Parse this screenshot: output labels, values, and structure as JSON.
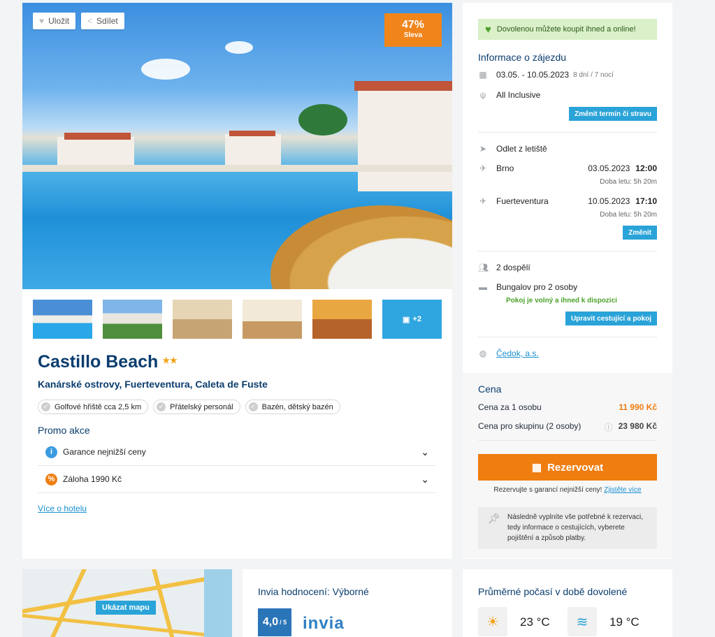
{
  "hotel": {
    "save_label": "Uložit",
    "share_label": "Sdílet",
    "discount_pct": "47%",
    "discount_label": "Sleva",
    "more_photos": "+2",
    "name": "Castillo Beach",
    "stars": "★★",
    "location": "Kanárské ostrovy, Fuerteventura, Caleta de Fuste",
    "tags": [
      "Golfové hřiště cca 2,5 km",
      "Přátelský personál",
      "Bazén, dětský bazén"
    ],
    "promo_title": "Promo akce",
    "promos": [
      {
        "label": "Garance nejnižší ceny",
        "icon": "info-icon",
        "color": "#3b9be0"
      },
      {
        "label": "Záloha 1990 Kč",
        "icon": "percent-icon",
        "color": "#ef7d10"
      }
    ],
    "more_link": "Více o hotelu"
  },
  "side": {
    "banner": "Dovolenou můžete koupit ihned a online!",
    "info_title": "Informace o zájezdu",
    "dates": "03.05. - 10.05.2023",
    "duration": "8 dní / 7 nocí",
    "board": "All Inclusive",
    "change_btn": "Změnit termín či stravu",
    "departure_label": "Odlet z letiště",
    "flights": [
      {
        "place": "Brno",
        "date": "03.05.2023",
        "time": "12:00",
        "duration": "Doba letu: 5h 20m"
      },
      {
        "place": "Fuerteventura",
        "date": "10.05.2023",
        "time": "17:10",
        "duration": "Doba letu: 5h 20m"
      }
    ],
    "change_flight_btn": "Změnit",
    "travelers": "2 dospělí",
    "room": "Bungalov pro 2 osoby",
    "room_status": "Pokoj je volný a ihned k dispozici",
    "edit_btn": "Upravit cestující a pokoj",
    "operator": "Čedok, a.s.",
    "price_title": "Cena",
    "price_person_label": "Cena za 1 osobu",
    "price_person": "11 990 Kč",
    "price_group_label": "Cena pro skupinu (2 osoby)",
    "price_group": "23 980 Kč",
    "reserve_btn": "Rezervovat",
    "reserve_note": "Rezervujte s garancí nejnižší ceny!",
    "reserve_link": "Zjistěte více",
    "info_note": "Následně vyplníte vše potřebné k rezervaci, tedy informace o cestujících, vyberete pojištění a způsob platby."
  },
  "map": {
    "button": "Ukázat mapu"
  },
  "rating": {
    "title": "Invia hodnocení: Výborné",
    "score": "4,0",
    "scale": "/ 5",
    "logo": "invia"
  },
  "weather": {
    "title": "Průměrné počasí v době dovolené",
    "air": "23 °C",
    "water": "19 °C"
  },
  "colors": {
    "accent": "#ef7d10",
    "blue": "#2aa3d8",
    "navy": "#0b3d6e",
    "green": "#4aa129"
  }
}
